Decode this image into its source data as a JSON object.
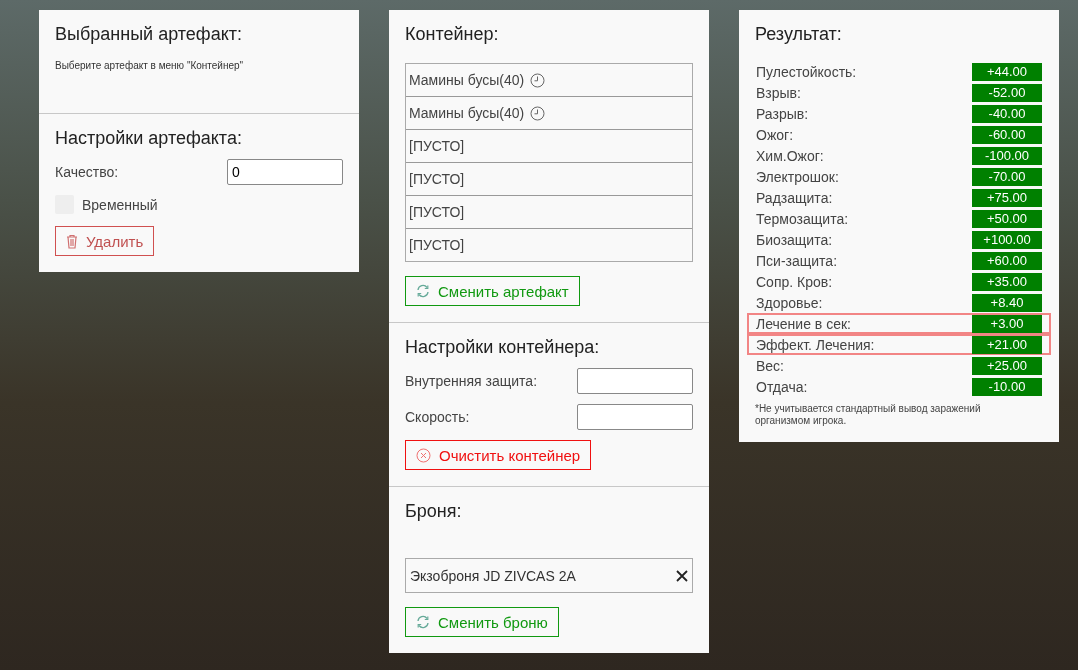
{
  "artifact_panel": {
    "title": "Выбранный артефакт:",
    "hint": "Выберите артефакт в меню \"Контейнер\"",
    "settings_title": "Настройки артефакта:",
    "quality": {
      "label": "Качество:",
      "value": "0"
    },
    "temporary": {
      "label": "Временный",
      "checked": false
    },
    "button": {
      "label": "Удалить",
      "kind": "delete"
    }
  },
  "container_panel": {
    "title": "Контейнер:",
    "slots": [
      {
        "label": "Мамины бусы(40)",
        "temporary": true
      },
      {
        "label": "Мамины бусы(40)",
        "temporary": true
      },
      {
        "label": "[ПУСТО]",
        "temporary": false
      },
      {
        "label": "[ПУСТО]",
        "temporary": false
      },
      {
        "label": "[ПУСТО]",
        "temporary": false
      },
      {
        "label": "[ПУСТО]",
        "temporary": false
      }
    ],
    "swap_button": {
      "label": "Сменить артефакт",
      "kind": "swap"
    },
    "settings_title": "Настройки контейнера:",
    "fields": [
      {
        "label": "Внутренняя защита:"
      },
      {
        "label": "Скорость:"
      }
    ],
    "clear_button": {
      "label": "Очистить контейнер",
      "kind": "clear"
    },
    "armor_title": "Броня:",
    "armor_value": "Экзоброня JD ZIVCAS 2A",
    "armor_button": {
      "label": "Сменить броню",
      "kind": "swap"
    }
  },
  "result_panel": {
    "title": "Результат:",
    "rows": [
      {
        "label": "Пулестойкость:",
        "value": "+44.00",
        "highlighted": false
      },
      {
        "label": "Взрыв:",
        "value": "-52.00",
        "highlighted": false
      },
      {
        "label": "Разрыв:",
        "value": "-40.00",
        "highlighted": false
      },
      {
        "label": "Ожог:",
        "value": "-60.00",
        "highlighted": false
      },
      {
        "label": "Хим.Ожог:",
        "value": "-100.00",
        "highlighted": false
      },
      {
        "label": "Электрошок:",
        "value": "-70.00",
        "highlighted": false
      },
      {
        "label": "Радзащита:",
        "value": "+75.00",
        "highlighted": false
      },
      {
        "label": "Термозащита:",
        "value": "+50.00",
        "highlighted": false
      },
      {
        "label": "Биозащита:",
        "value": "+100.00",
        "highlighted": false
      },
      {
        "label": "Пси-защита:",
        "value": "+60.00",
        "highlighted": false
      },
      {
        "label": "Сопр. Кров:",
        "value": "+35.00",
        "highlighted": false
      },
      {
        "label": "Здоровье:",
        "value": "+8.40",
        "highlighted": false
      },
      {
        "label": "Лечение в сек:",
        "value": "+3.00",
        "highlighted": true
      },
      {
        "label": "Эффект. Лечения:",
        "value": "+21.00",
        "highlighted": true
      },
      {
        "label": "Вес:",
        "value": "+25.00",
        "highlighted": false
      },
      {
        "label": "Отдача:",
        "value": "-10.00",
        "highlighted": false
      }
    ],
    "footnote": "*Не учитывается стандартный вывод заражений организмом игрока."
  }
}
